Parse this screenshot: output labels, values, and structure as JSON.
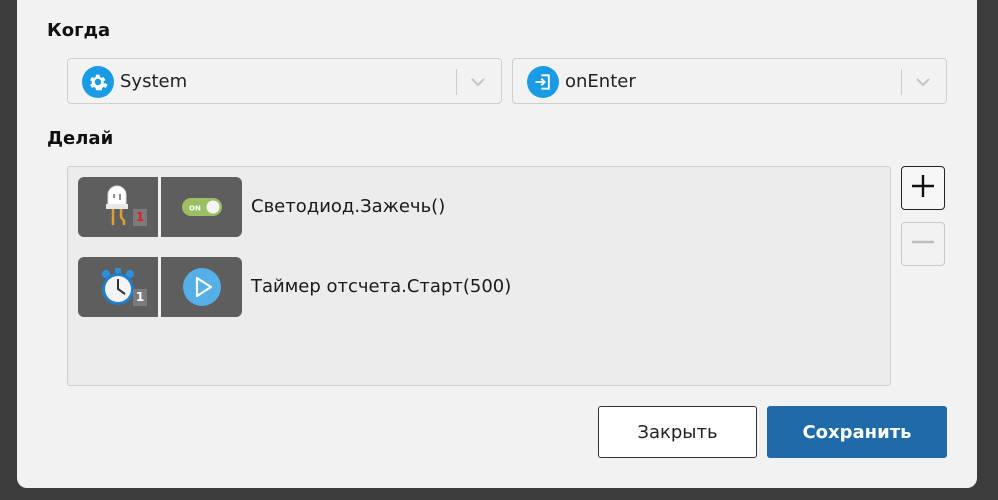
{
  "when": {
    "heading": "Когда",
    "source": {
      "label": "System",
      "icon": "gear-icon"
    },
    "event": {
      "label": "onEnter",
      "icon": "enter-icon"
    }
  },
  "do": {
    "heading": "Делай",
    "actions": [
      {
        "device_icon": "led-icon",
        "badge": "1",
        "action_icon": "toggle-on-icon",
        "toggle_text": "ON",
        "text": "Светодиод.Зажечь()"
      },
      {
        "device_icon": "stopwatch-icon",
        "badge": "1",
        "action_icon": "play-icon",
        "text": "Таймер отсчета.Старт(500)"
      }
    ]
  },
  "buttons": {
    "close": "Закрыть",
    "save": "Сохранить"
  },
  "colors": {
    "accent": "#1a9be6",
    "primary_button": "#1f6aa8",
    "tile": "#5e5e5e"
  }
}
